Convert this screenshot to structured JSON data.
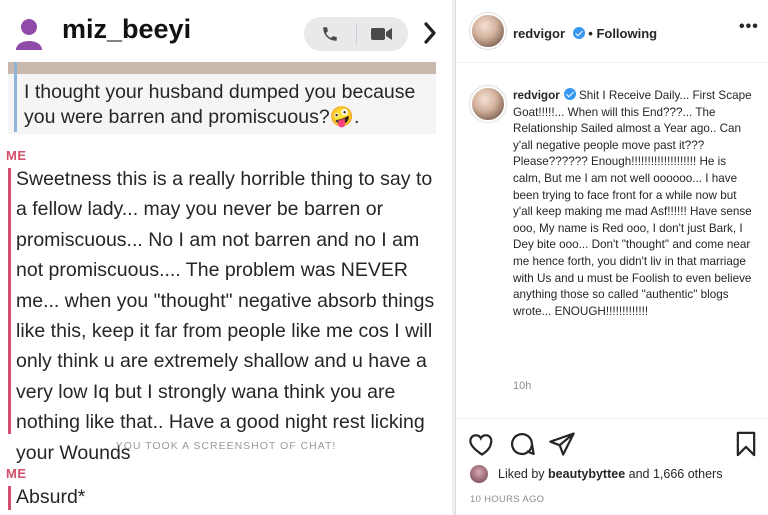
{
  "chat": {
    "username": "miz_beeyi",
    "quoted_message": "I thought your husband dumped you because you were barren and promiscuous?🤪.",
    "me_label": "ME",
    "reply_message": "Sweetness this is a really horrible thing to say to a fellow lady... may you never be barren or promiscuous... No I am not barren and no I am not promiscuous.... The problem was NEVER me... when you \"thought\" negative absorb things like this, keep it far from people like me cos I will only think u are extremely shallow and u have a very low Iq but I strongly wana think you are nothing like that.. Have a good night rest licking your Wounds",
    "screenshot_notice": "YOU TOOK A SCREENSHOT OF CHAT!",
    "me_label_2": "ME",
    "last_message": "Absurd*",
    "icons": {
      "call": "phone-icon",
      "video": "video-camera-icon",
      "next": "chevron-right-icon",
      "avatar": "person-silhouette-icon"
    },
    "colors": {
      "accent": "#d3506d",
      "quote_bar": "#8fb3d9",
      "avatar": "#8e4ba8"
    }
  },
  "post": {
    "username": "redvigor",
    "follow_status": "Following",
    "more_label": "•••",
    "caption_user": "redvigor",
    "caption": "Shit I Receive Daily... First Scape Goat!!!!!... When will this End???... The Relationship Sailed almost a Year ago.. Can y'all negative people move past it??? Please?????? Enough!!!!!!!!!!!!!!!!!!!! He is calm, But me I am not well oooooo... I have been trying to face front for a while now but y'all keep making me mad Asf!!!!!! Have sense ooo, My name is Red ooo, I don't just Bark, I Dey bite ooo... Don't \"thought\" and come near me hence forth, you didn't liv in that marriage with Us and u must be Foolish to even believe anything those so called \"authentic\" blogs wrote... ENOUGH!!!!!!!!!!!!!",
    "caption_time": "10h",
    "liked_prefix": "Liked by",
    "liked_user": "beautybyttee",
    "liked_suffix": "and 1,666 others",
    "posted_ago": "10 HOURS AGO",
    "icons": {
      "like": "heart-icon",
      "comment": "comment-icon",
      "share": "paper-plane-icon",
      "save": "bookmark-icon",
      "verified": "verified-badge-icon"
    },
    "colors": {
      "verified": "#3897f0"
    }
  }
}
